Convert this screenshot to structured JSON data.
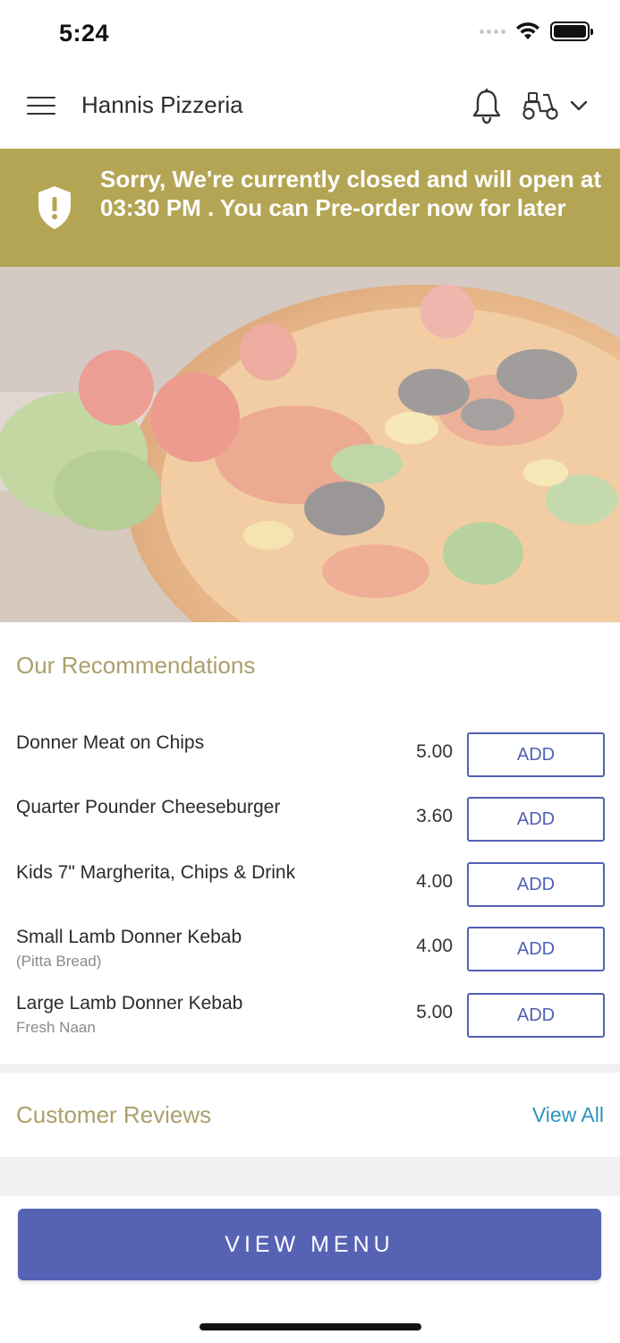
{
  "status_bar": {
    "time": "5:24"
  },
  "header": {
    "restaurant_name": "Hannis Pizzeria",
    "icons": [
      "menu-icon",
      "bell-icon",
      "scooter-icon",
      "chevron-down-icon"
    ]
  },
  "banner": {
    "message": "Sorry, We're currently closed and will open at 03:30 PM . You can Pre-order now for later",
    "color": "#b4a555"
  },
  "recommendations": {
    "title": "Our Recommendations",
    "items": [
      {
        "name": "Donner Meat on Chips",
        "subtitle": "",
        "price": "5.00",
        "button": "ADD"
      },
      {
        "name": "Quarter Pounder Cheeseburger",
        "subtitle": "",
        "price": "3.60",
        "button": "ADD"
      },
      {
        "name": "Kids 7\" Margherita, Chips & Drink",
        "subtitle": "",
        "price": "4.00",
        "button": "ADD"
      },
      {
        "name": "Small Lamb Donner Kebab",
        "subtitle": "(Pitta Bread)",
        "price": "4.00",
        "button": "ADD"
      },
      {
        "name": "Large Lamb Donner Kebab",
        "subtitle": "Fresh Naan",
        "price": "5.00",
        "button": "ADD"
      }
    ]
  },
  "reviews": {
    "title": "Customer Reviews",
    "view_all": "View All"
  },
  "footer": {
    "view_menu": "VIEW MENU"
  },
  "colors": {
    "accent": "#5663b5",
    "section_title": "#ab9f6d",
    "link": "#2f93c0"
  }
}
